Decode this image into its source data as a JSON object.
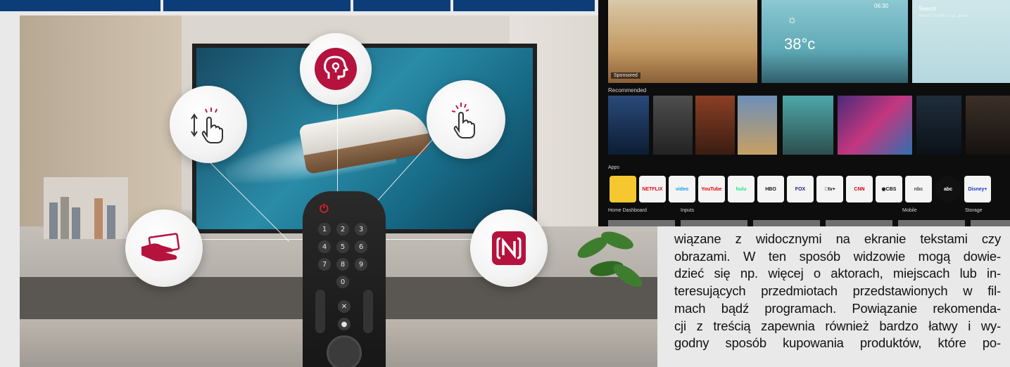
{
  "remote": {
    "keys": [
      "1",
      "2",
      "3",
      "4",
      "5",
      "6",
      "7",
      "8",
      "9",
      "0"
    ]
  },
  "icons": {
    "bubble_left_top": "scroll-touch-icon",
    "bubble_center": "voice-recognition-icon",
    "bubble_right_top": "pointer-click-icon",
    "bubble_left_bottom": "payment-card-icon",
    "bubble_right_bottom": "nfc-icon"
  },
  "colors": {
    "header_blue": "#0c3d78",
    "brand_red": "#b5123e"
  },
  "tv_screen": {
    "sponsored": "Sponsored",
    "temperature": "38°c",
    "time": "06:30",
    "search_label": "Search",
    "search_hint": "Search by title, cast, genre",
    "recommended_label": "Recommended",
    "apps_label": "Apps",
    "apps": [
      "NETFLIX",
      "video",
      "YouTube",
      "hulu",
      "HBO",
      "FOX",
      "\u0000tv+",
      "CNN",
      "◉CBS",
      "nbc",
      "abc",
      "Disney+"
    ],
    "bottom_labels": [
      "Home Dashboard",
      "Inputs",
      "Mobile",
      "Storage"
    ]
  },
  "article": {
    "lines": [
      "wiązane z widocznymi na ekranie tekstami czy",
      "obrazami. W ten sposób widzowie mogą dowie-",
      "dzieć się np. więcej o aktorach, miejscach lub in-",
      "teresujących przedmiotach przedstawionych w fil-",
      "mach bądź programach. Powiązanie rekomenda-",
      "cji z treścią zapewnia również bardzo łatwy i wy-",
      "godny sposób kupowania produktów, które po-"
    ]
  }
}
